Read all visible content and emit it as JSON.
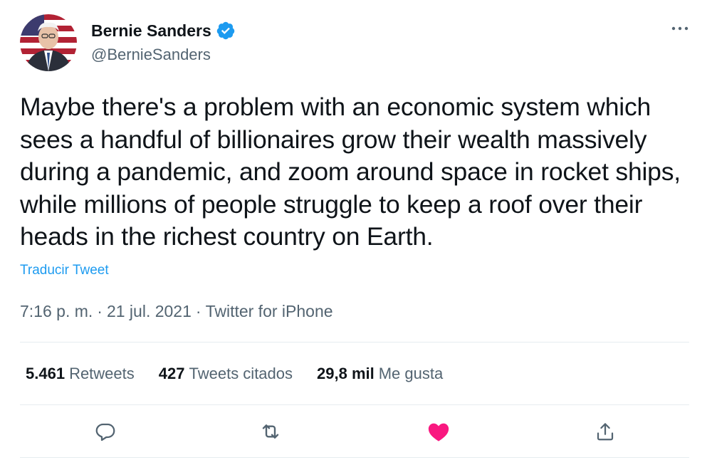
{
  "author": {
    "display_name": "Bernie Sanders",
    "handle": "@BernieSanders",
    "verified_icon": "verified-badge-icon"
  },
  "tweet": {
    "text": "Maybe there's a problem with an economic system which sees a handful of billionaires grow their wealth massively during a pandemic, and zoom around space in rocket ships, while millions of people struggle to keep a roof over their heads in the richest country on Earth.",
    "translate_label": "Traducir Tweet",
    "time": "7:16 p. m.",
    "date": "21 jul. 2021",
    "source": "Twitter for iPhone",
    "separator": "·"
  },
  "stats": {
    "retweets_count": "5.461",
    "retweets_label": "Retweets",
    "quotes_count": "427",
    "quotes_label": "Tweets citados",
    "likes_count": "29,8 mil",
    "likes_label": "Me gusta"
  },
  "actions": {
    "reply_icon": "reply-icon",
    "retweet_icon": "retweet-icon",
    "like_icon": "heart-icon",
    "share_icon": "share-icon",
    "liked": true
  },
  "colors": {
    "accent": "#1d9bf0",
    "like": "#f91880",
    "text": "#0f1419",
    "secondary": "#536471",
    "divider": "#e6ecf0"
  }
}
